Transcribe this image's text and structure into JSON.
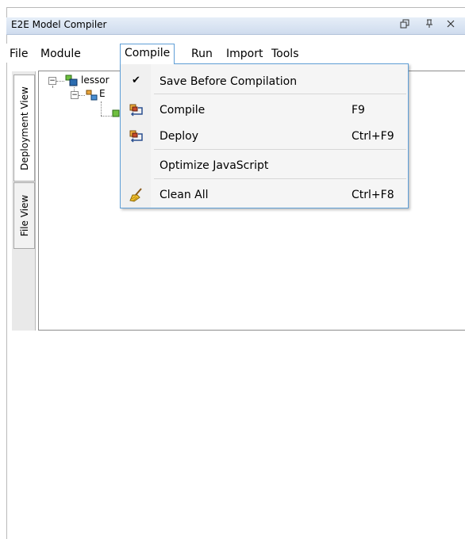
{
  "window": {
    "title": "E2E Model Compiler",
    "buttons": [
      "restore-icon",
      "pin-icon",
      "close-icon"
    ]
  },
  "menubar": {
    "items": [
      "File",
      "Module",
      "Compile",
      "Run",
      "Import",
      "Tools"
    ],
    "open": "Compile"
  },
  "side_tabs": [
    "Deployment View",
    "File View"
  ],
  "tree": {
    "root_label": "lessor",
    "child_label": "E"
  },
  "compile_menu": {
    "items": [
      {
        "label": "Save Before Compilation",
        "shortcut": "",
        "checked": true
      },
      {
        "label": "Compile",
        "shortcut": "F9",
        "icon": "compile-icon"
      },
      {
        "label": "Deploy",
        "shortcut": "Ctrl+F9",
        "icon": "deploy-icon"
      },
      {
        "label": "Optimize JavaScript",
        "shortcut": ""
      },
      {
        "label": "Clean All",
        "shortcut": "Ctrl+F8",
        "icon": "broom-icon"
      }
    ],
    "check_glyph": "✔"
  },
  "colors": {
    "menu_border": "#5f9fd6",
    "titlebar": "#dbe5f3"
  }
}
